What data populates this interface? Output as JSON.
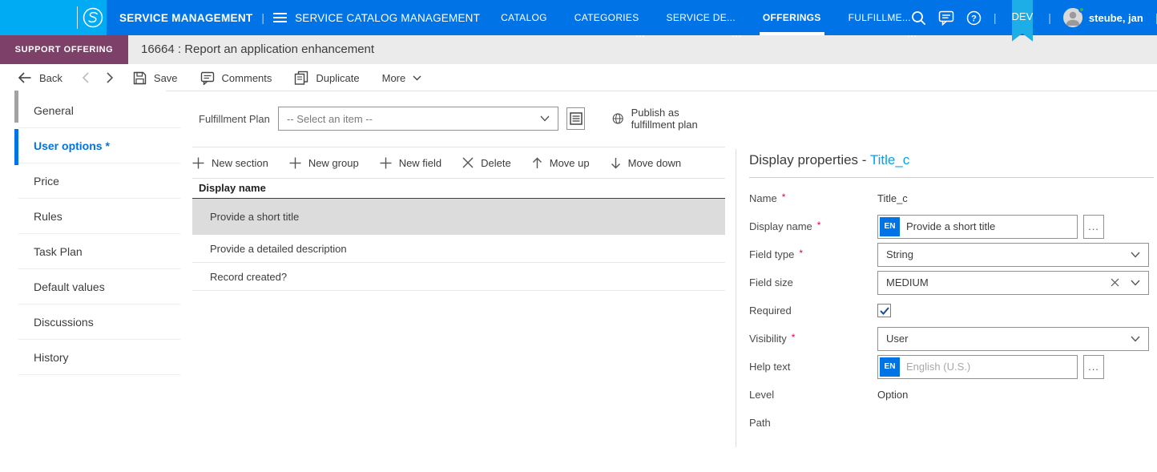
{
  "topnav": {
    "product_title": "SERVICE MANAGEMENT",
    "app_title": "SERVICE CATALOG MANAGEMENT",
    "tabs": [
      {
        "label": "CATALOG"
      },
      {
        "label": "CATEGORIES",
        "dots": "..."
      },
      {
        "label": "SERVICE DE...",
        "dots": "..."
      },
      {
        "label": "OFFERINGS",
        "active": true
      },
      {
        "label": "FULFILLME...",
        "dots": "..."
      }
    ],
    "env_badge": "DEV",
    "user": {
      "name": "steube, jan",
      "presence": "online"
    },
    "icons": [
      "search-icon",
      "chat-icon",
      "help-icon",
      "chevron-down-icon"
    ]
  },
  "record_bar": {
    "type_badge": "SUPPORT OFFERING",
    "title": "16664 : Report an application enhancement"
  },
  "toolbar": {
    "back_label": "Back",
    "save_label": "Save",
    "comments_label": "Comments",
    "duplicate_label": "Duplicate",
    "more_label": "More"
  },
  "sidebar": {
    "items": [
      {
        "label": "General"
      },
      {
        "label": "User options *",
        "active": true
      },
      {
        "label": "Price"
      },
      {
        "label": "Rules"
      },
      {
        "label": "Task Plan"
      },
      {
        "label": "Default values"
      },
      {
        "label": "Discussions"
      },
      {
        "label": "History"
      }
    ]
  },
  "fulfillment": {
    "label": "Fulfillment Plan",
    "selected_value": "-- Select an item --",
    "publish_label": "Publish as fulfillment plan"
  },
  "options_toolbar": {
    "new_section": "New section",
    "new_group": "New group",
    "new_field": "New field",
    "delete_label": "Delete",
    "move_up": "Move up",
    "move_down": "Move down"
  },
  "options_table": {
    "header": "Display name",
    "rows": [
      {
        "label": "Provide a short title",
        "selected": true
      },
      {
        "label": "Provide a detailed description"
      },
      {
        "label": "Record created?"
      }
    ]
  },
  "panel": {
    "title_prefix": "Display properties - ",
    "entity_name": "Title_c",
    "fields": {
      "name": {
        "label": "Name",
        "required_mark": "*",
        "value": "Title_c"
      },
      "display_name": {
        "label": "Display name",
        "required_mark": "*",
        "lang": "EN",
        "value": "Provide a short title",
        "more_label": "..."
      },
      "field_type": {
        "label": "Field type",
        "required_mark": "*",
        "value": "String"
      },
      "field_size": {
        "label": "Field size",
        "value": "MEDIUM"
      },
      "required": {
        "label": "Required",
        "checked": true
      },
      "visibility": {
        "label": "Visibility",
        "required_mark": "*",
        "value": "User"
      },
      "help_text": {
        "label": "Help text",
        "lang": "EN",
        "placeholder": "English (U.S.)",
        "more_label": "..."
      },
      "level": {
        "label": "Level",
        "value": "Option"
      },
      "path": {
        "label": "Path",
        "value": ""
      }
    }
  },
  "colors": {
    "nav_blue": "#0073e7",
    "brand_cyan": "#00abf3",
    "env_ribbon_cyan": "#1daee8",
    "badge_purple": "#7d4169",
    "entity_link_cyan": "#00a2e8",
    "required_red": "#e5004c",
    "selected_row_gray": "#dcdcdc",
    "record_bar_gray": "#ebebeb"
  }
}
